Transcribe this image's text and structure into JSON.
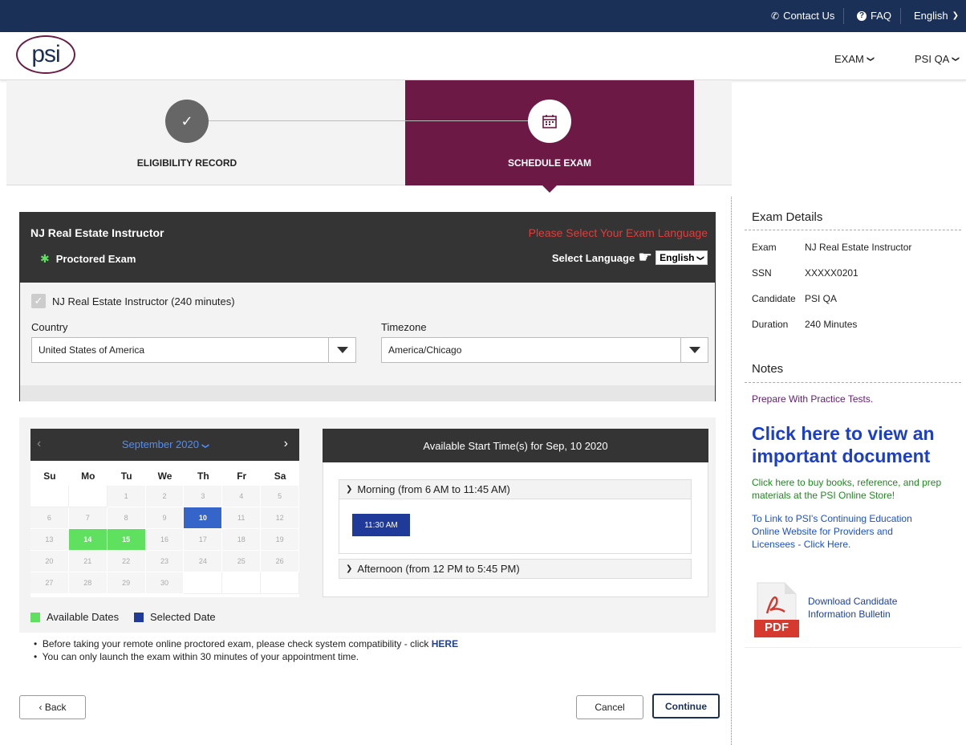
{
  "topbar": {
    "contact": "Contact Us",
    "faq": "FAQ",
    "language": "English"
  },
  "header": {
    "logo": "psi",
    "nav": [
      "EXAM",
      "PSI QA"
    ]
  },
  "steps": [
    {
      "label": "ELIGIBILITY RECORD",
      "status": "complete"
    },
    {
      "label": "SCHEDULE EXAM",
      "status": "active"
    }
  ],
  "exam": {
    "title": "NJ Real Estate Instructor",
    "mode": "Proctored Exam",
    "language_prompt": "Please Select Your Exam Language",
    "select_language_label": "Select Language",
    "selected_language": "English",
    "checkbox_label": "NJ Real Estate Instructor (240 minutes)",
    "country_label": "Country",
    "country_value": "United States of America",
    "timezone_label": "Timezone",
    "timezone_value": "America/Chicago"
  },
  "calendar": {
    "month": "September 2020",
    "prev": "‹",
    "next": "›",
    "days_of_week": [
      "Su",
      "Mo",
      "Tu",
      "We",
      "Th",
      "Fr",
      "Sa"
    ],
    "weeks": [
      [
        "",
        "",
        "1",
        "2",
        "3",
        "4",
        "5"
      ],
      [
        "6",
        "7",
        "8",
        "9",
        "10",
        "11",
        "12"
      ],
      [
        "13",
        "14",
        "15",
        "16",
        "17",
        "18",
        "19"
      ],
      [
        "20",
        "21",
        "22",
        "23",
        "24",
        "25",
        "26"
      ],
      [
        "27",
        "28",
        "29",
        "30",
        "",
        "",
        ""
      ]
    ],
    "available_dates": [
      "14",
      "15"
    ],
    "selected_date": "10"
  },
  "times": {
    "header": "Available Start Time(s) for Sep, 10 2020",
    "morning_label": "Morning (from 6 AM to 11:45 AM)",
    "morning_slots": [
      "11:30 AM"
    ],
    "afternoon_label": "Afternoon (from 12 PM to 5:45 PM)"
  },
  "legend": {
    "available": "Available Dates",
    "selected": "Selected Date",
    "available_color": "#5fe05f",
    "selected_color": "#1f3a99"
  },
  "notes_bullets": {
    "b1_text": "Before taking your remote online proctored exam, please check system compatibility - click ",
    "b1_link": "HERE",
    "b2_text": "You can only launch the exam within 30 minutes of your appointment time."
  },
  "buttons": {
    "back": "‹ Back",
    "cancel": "Cancel",
    "continue": "Continue"
  },
  "sidebar": {
    "details_title": "Exam Details",
    "details": [
      {
        "k": "Exam",
        "v": "NJ Real Estate Instructor"
      },
      {
        "k": "SSN",
        "v": "XXXXX0201"
      },
      {
        "k": "Candidate",
        "v": "PSI QA"
      },
      {
        "k": "Duration",
        "v": "240 Minutes"
      }
    ],
    "notes_title": "Notes",
    "practice": "Prepare With Practice Tests.",
    "doc_link": "Click here to view an important document",
    "books_link": "Click here to buy books, reference, and prep materials at the PSI Online Store!",
    "ce_link": "To Link to PSI's Continuing Education Online Website for Providers and Licensees - Click Here.",
    "bulletin_link": "Download Candidate Information Bulletin",
    "pdf_label": "PDF"
  },
  "colors": {
    "navy": "#1b3056",
    "maroon": "#6c1a45",
    "dark": "#343434",
    "red_prompt": "#e23b3b",
    "purple_link": "#6c1a80",
    "green_link": "#1e8a1e",
    "blue_link": "#1b4fd6"
  }
}
